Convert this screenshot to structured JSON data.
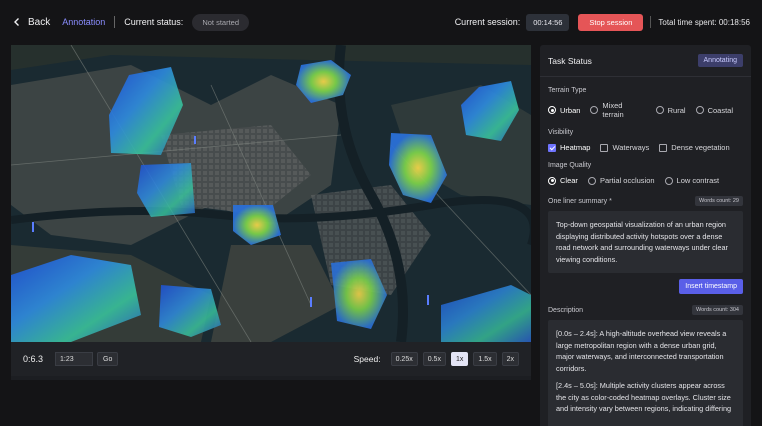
{
  "header": {
    "back_label": "Back",
    "tab_label": "Annotation",
    "status_label": "Current status:",
    "status_value": "Not started",
    "session_label": "Current session:",
    "session_timer": "00:14:56",
    "stop_label": "Stop session",
    "total_time": "Total time spent: 00:18:56"
  },
  "player": {
    "time": "0:6.3",
    "jump_input": "1:23",
    "go_label": "Go",
    "speed_label": "Speed:",
    "speeds": [
      "0.25x",
      "0.5x",
      "1x",
      "1.5x",
      "2x"
    ],
    "active_speed": "1x"
  },
  "panel": {
    "title": "Task Status",
    "badge": "Annotating",
    "terrain": {
      "label": "Terrain Type",
      "options": [
        "Urban",
        "Mixed terrain",
        "Rural",
        "Coastal"
      ],
      "selected": "Urban"
    },
    "visibility": {
      "label": "Visibility",
      "options": [
        "Heatmap",
        "Waterways",
        "Dense vegetation"
      ],
      "checked": [
        "Heatmap"
      ]
    },
    "quality": {
      "label": "Image Quality",
      "options": [
        "Clear",
        "Partial occlusion",
        "Low contrast"
      ],
      "selected": "Clear"
    },
    "summary": {
      "label": "One liner summary *",
      "words": "Words count: 29",
      "text": "Top-down geospatial visualization of an urban region displaying distributed activity hotspots over a dense road network and surrounding waterways under clear viewing conditions."
    },
    "insert_label": "Insert timestamp",
    "description": {
      "label": "Description",
      "words": "Words count: 304",
      "paragraphs": [
        "[0.0s – 2.4s]: A high-altitude overhead view reveals a large metropolitan region with a dense urban grid, major waterways, and interconnected transportation corridors.",
        "[2.4s – 5.0s]: Multiple activity clusters appear across the city as color-coded heatmap overlays. Cluster size and intensity vary between regions, indicating differing"
      ]
    }
  },
  "colors": {
    "accent": "#8a8dff",
    "stop": "#e55557",
    "badge_bg": "#3c3e6a",
    "insert": "#5a5fe8"
  }
}
